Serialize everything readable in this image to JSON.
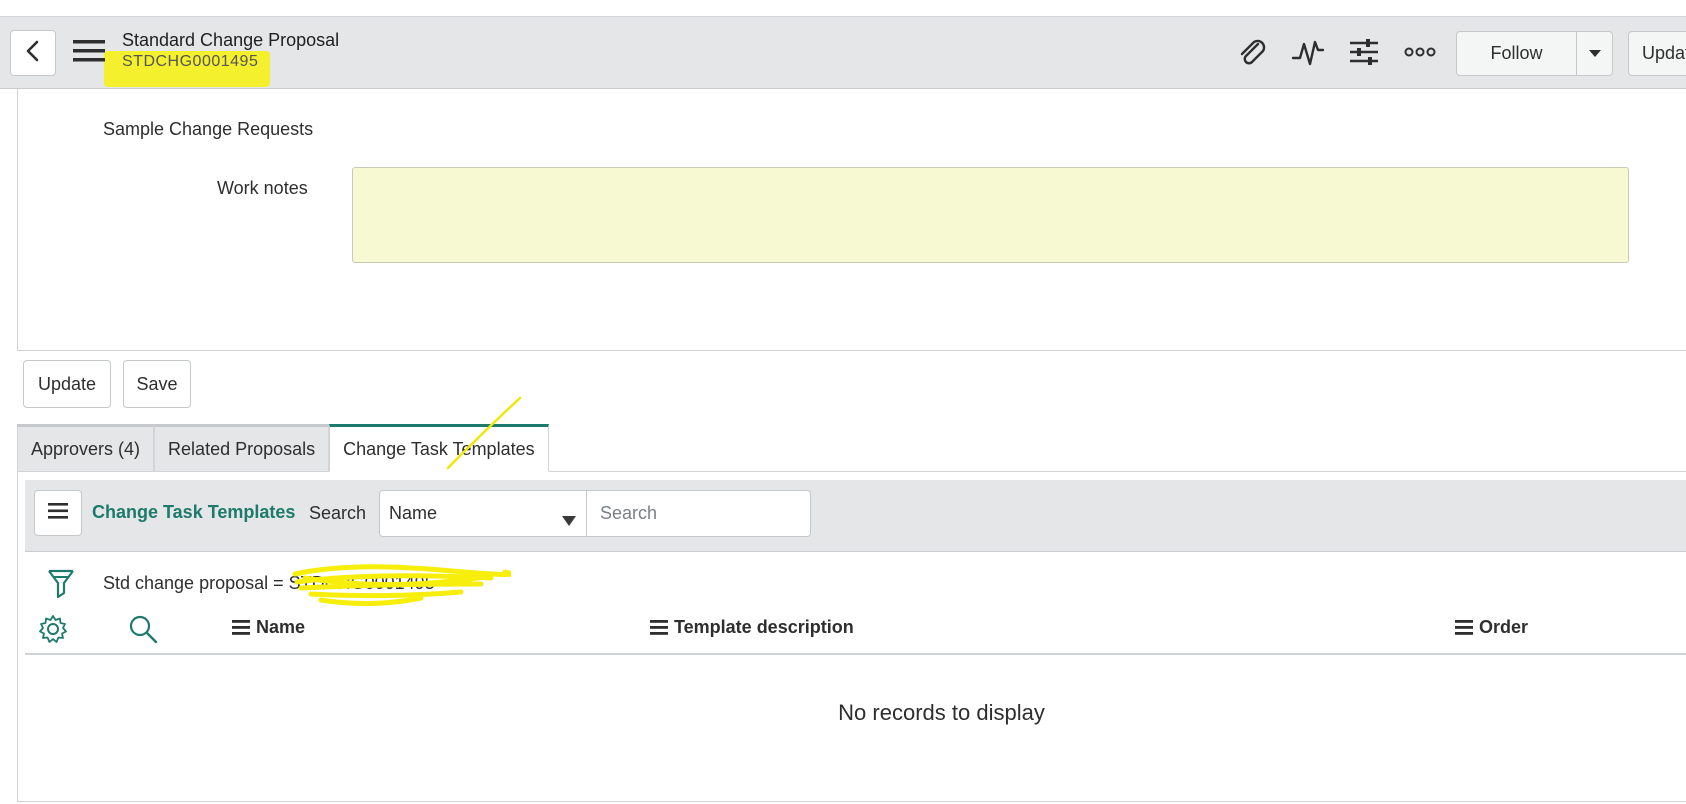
{
  "header": {
    "back_icon": "chevron-left-icon",
    "menu_icon": "hamburger-menu-icon",
    "record_title": "Standard Change Proposal",
    "record_number": "STDCHG0001495",
    "highlight_color": "#f7f10c",
    "icons": [
      "paperclip-icon",
      "activity-pulse-icon",
      "sliders-icon",
      "more-options-icon"
    ],
    "follow_label": "Follow",
    "update_label": "Updat"
  },
  "form": {
    "section_label": "Sample Change Requests",
    "work_notes_label": "Work notes",
    "work_notes_value": "",
    "work_notes_bg": "#f7f9d2"
  },
  "actions": {
    "update_label": "Update",
    "save_label": "Save"
  },
  "tabs": [
    {
      "label": "Approvers (4)",
      "active": false
    },
    {
      "label": "Related Proposals",
      "active": false
    },
    {
      "label": "Change Task Templates",
      "active": true
    }
  ],
  "related_list": {
    "title": "Change Task Templates",
    "search_label": "Search",
    "search_field_selected": "Name",
    "search_placeholder": "Search",
    "filter_text": "Std change proposal = STDCHG0001495",
    "columns": [
      "Name",
      "Template description",
      "Order"
    ],
    "empty_message": "No records to display",
    "accent_color": "#1d7a6c"
  }
}
